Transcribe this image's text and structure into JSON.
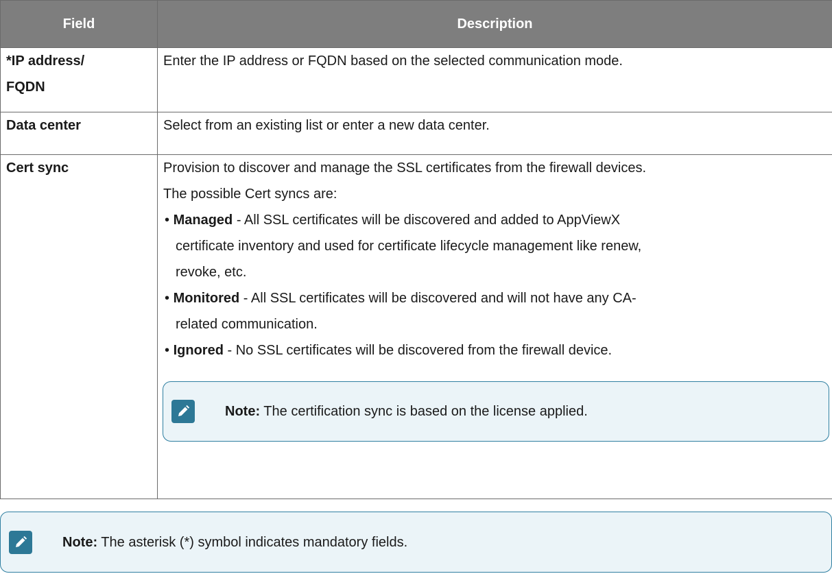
{
  "table": {
    "headers": {
      "field": "Field",
      "description": "Description"
    },
    "rows": [
      {
        "field_line1": "*IP address/",
        "field_line2": "FQDN",
        "description": "Enter the IP address or FQDN based on the selected communication mode."
      },
      {
        "field": "Data center",
        "description": "Select from an existing list or enter a new data center."
      },
      {
        "field": "Cert sync",
        "intro_line1": "Provision to discover and manage the SSL certificates from the firewall devices.",
        "intro_line2": "The possible Cert syncs are:",
        "options": [
          {
            "bullet": "•",
            "name": "Managed",
            "line1": " - All SSL certificates will be discovered and added to AppViewX",
            "line2": "certificate inventory and used for certificate lifecycle management like renew,",
            "line3": "revoke, etc."
          },
          {
            "bullet": "•",
            "name": "Monitored",
            "line1": " - All SSL certificates will be discovered and will not have any CA-",
            "line2": "related communication."
          },
          {
            "bullet": "•",
            "name": "Ignored",
            "line1": " - No SSL certificates will be discovered from the firewall device."
          }
        ],
        "note": {
          "icon": "edit-pencil-icon",
          "label": "Note:",
          "text": " The certification sync is based on the license applied."
        }
      }
    ]
  },
  "footer_note": {
    "icon": "edit-pencil-icon",
    "label": "Note:",
    "text": " The asterisk (*) symbol indicates mandatory fields."
  },
  "colors": {
    "header_bg": "#7e7e7e",
    "note_border": "#2f7fa1",
    "note_bg": "#ebf4f8",
    "note_icon_bg": "#2d7896"
  }
}
